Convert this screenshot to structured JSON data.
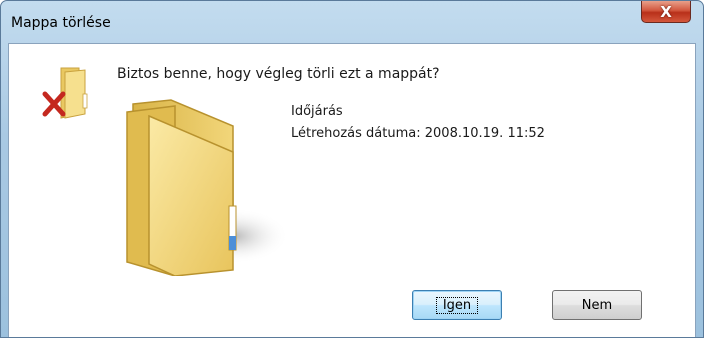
{
  "window": {
    "title": "Mappa törlése"
  },
  "dialog": {
    "question": "Biztos benne, hogy végleg törli ezt a mappát?",
    "item_name": "Időjárás",
    "item_date": "Létrehozás dátuma: 2008.10.19. 11:52"
  },
  "buttons": {
    "yes": "Igen",
    "no": "Nem",
    "close": "X"
  },
  "icons": {
    "delete": "red-x-icon",
    "folder": "folder-icon"
  },
  "colors": {
    "titlebar": "#a9c9e3",
    "close": "#c9432b",
    "folder": "#f0d67a"
  }
}
